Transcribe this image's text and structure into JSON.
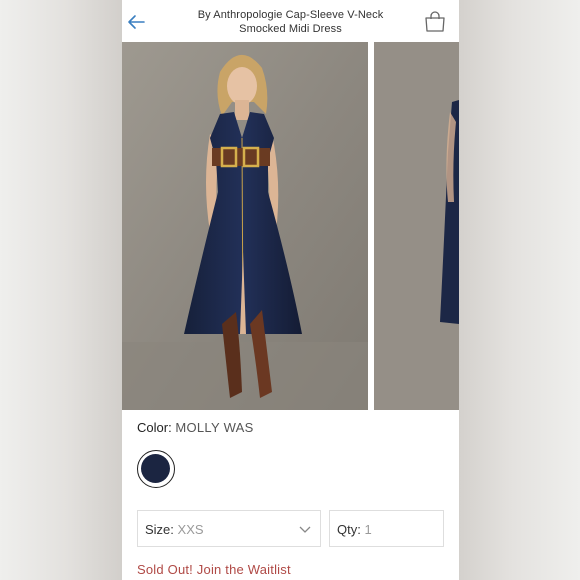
{
  "header": {
    "title": "By Anthropologie Cap-Sleeve V-Neck Smocked Midi Dress"
  },
  "product": {
    "color_label": "Color:",
    "color_value": "MOLLY WAS",
    "swatch_color": "#1b2541",
    "size_label": "Size:",
    "size_value": "XXS",
    "qty_label": "Qty:",
    "qty_value": "1",
    "waitlist_text": "Sold Out! Join the Waitlist"
  },
  "colors": {
    "accent": "#2a6fb0",
    "soldout": "#b04a46",
    "dress": "#1b2541"
  }
}
